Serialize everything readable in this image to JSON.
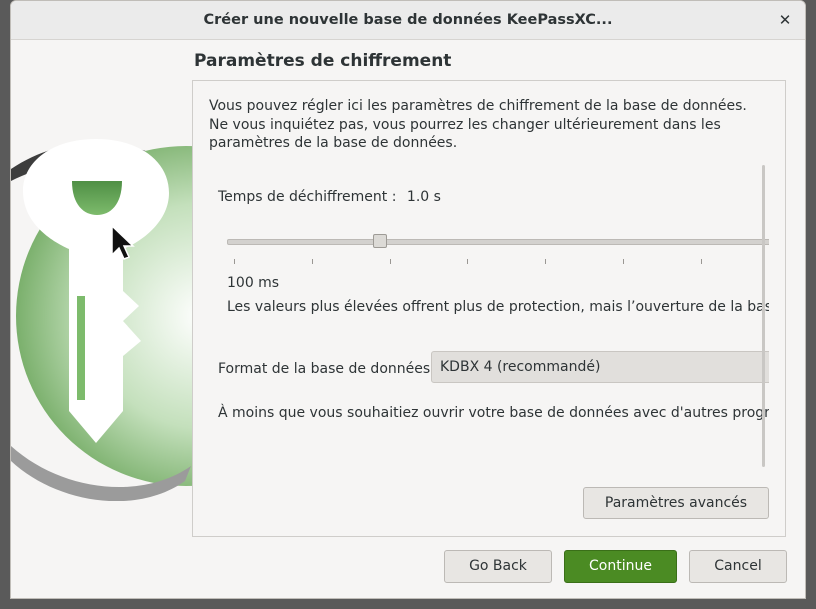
{
  "window": {
    "title": "Créer une nouvelle base de données KeePassXC...",
    "close_icon": "close-icon",
    "close_glyph": "✕"
  },
  "page": {
    "title": "Paramètres de chiffrement",
    "intro": "Vous pouvez régler ici les paramètres de chiffrement de la base de données. Ne vous inquiétez pas, vous pourrez les changer ultérieurement dans les paramètres de la base de données."
  },
  "decryption": {
    "label": "Temps de déchiffrement :",
    "value": "1.0 s",
    "slider_fraction": 0.28,
    "min_label": "100 ms",
    "hint": "Les valeurs plus élevées offrent plus de protection, mais l’ouverture de la base de"
  },
  "format": {
    "label": "Format de la base de données :",
    "selected": "KDBX 4 (recommandé)",
    "note": "À moins que vous souhaitiez ouvrir votre base de données avec d'autres programm"
  },
  "buttons": {
    "advanced": "Paramètres avancés",
    "back": "Go Back",
    "continue": "Continue",
    "cancel": "Cancel"
  },
  "colors": {
    "accent_green": "#4b8b23",
    "logo_green": "#6aa55a"
  }
}
